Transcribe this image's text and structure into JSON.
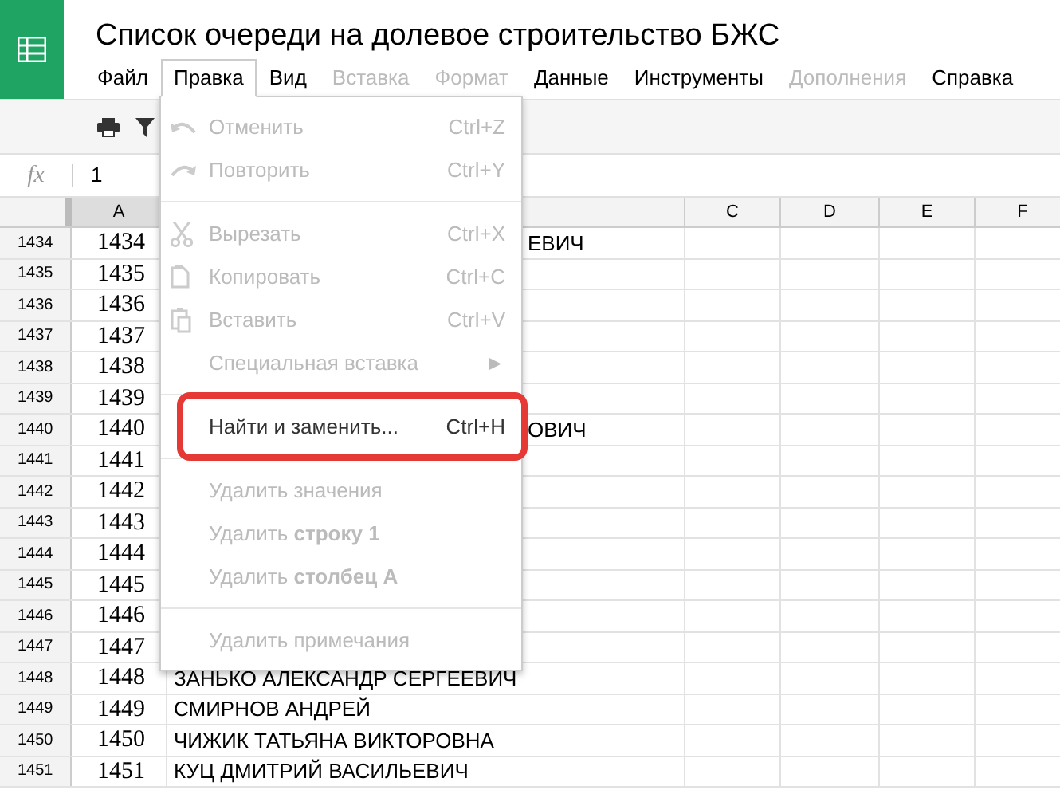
{
  "title": "Список очереди на долевое строительство БЖС",
  "menubar": [
    {
      "label": "Файл",
      "selected": false,
      "disabled": false
    },
    {
      "label": "Правка",
      "selected": true,
      "disabled": false
    },
    {
      "label": "Вид",
      "selected": false,
      "disabled": false
    },
    {
      "label": "Вставка",
      "selected": false,
      "disabled": true
    },
    {
      "label": "Формат",
      "selected": false,
      "disabled": true
    },
    {
      "label": "Данные",
      "selected": false,
      "disabled": false
    },
    {
      "label": "Инструменты",
      "selected": false,
      "disabled": false
    },
    {
      "label": "Дополнения",
      "selected": false,
      "disabled": true
    },
    {
      "label": "Справка",
      "selected": false,
      "disabled": false
    }
  ],
  "formula_bar": {
    "label": "fx",
    "value": "1"
  },
  "columns": [
    "A",
    "",
    "C",
    "D",
    "E",
    "F"
  ],
  "rows": [
    {
      "number": "1434",
      "a": "1434",
      "b": "ЕВИЧ",
      "kind": "partial"
    },
    {
      "number": "1435",
      "a": "1435"
    },
    {
      "number": "1436",
      "a": "1436"
    },
    {
      "number": "1437",
      "a": "1437"
    },
    {
      "number": "1438",
      "a": "1438"
    },
    {
      "number": "1439",
      "a": "1439"
    },
    {
      "number": "1440",
      "a": "1440",
      "b": "ОВИЧ",
      "kind": "partial"
    },
    {
      "number": "1441",
      "a": "1441"
    },
    {
      "number": "1442",
      "a": "1442"
    },
    {
      "number": "1443",
      "a": "1443"
    },
    {
      "number": "1444",
      "a": "1444"
    },
    {
      "number": "1445",
      "a": "1445"
    },
    {
      "number": "1446",
      "a": "1446"
    },
    {
      "number": "1447",
      "a": "1447"
    },
    {
      "number": "1448",
      "a": "1448",
      "b": "ЗАНЬКО АЛЕКСАНДР СЕРГЕЕВИЧ",
      "kind": "full"
    },
    {
      "number": "1449",
      "a": "1449",
      "b": "СМИРНОВ АНДРЕЙ",
      "kind": "full"
    },
    {
      "number": "1450",
      "a": "1450",
      "b": "ЧИЖИК ТАТЬЯНА ВИКТОРОВНА",
      "kind": "full"
    },
    {
      "number": "1451",
      "a": "1451",
      "b": "КУЦ ДМИТРИЙ ВАСИЛЬЕВИЧ",
      "kind": "full"
    }
  ],
  "edit_menu": [
    {
      "kind": "item",
      "label": "Отменить",
      "shortcut": "Ctrl+Z",
      "disabled": true,
      "marked": false
    },
    {
      "kind": "item",
      "label": "Повторить",
      "shortcut": "Ctrl+Y",
      "disabled": true,
      "marked": false
    },
    {
      "kind": "separator"
    },
    {
      "kind": "item",
      "label": "Вырезать",
      "shortcut": "Ctrl+X",
      "disabled": true,
      "marked": false
    },
    {
      "kind": "item",
      "label": "Копировать",
      "shortcut": "Ctrl+C",
      "disabled": true,
      "marked": false
    },
    {
      "kind": "item",
      "label": "Вставить",
      "shortcut": "Ctrl+V",
      "disabled": true,
      "marked": false
    },
    {
      "kind": "item",
      "label": "Специальная вставка",
      "shortcut": "►",
      "disabled": true,
      "marked": false
    },
    {
      "kind": "separator"
    },
    {
      "kind": "item",
      "label": "Найти и заменить...",
      "shortcut": "Ctrl+H",
      "disabled": false,
      "marked": true
    },
    {
      "kind": "separator"
    },
    {
      "kind": "item",
      "label": "Удалить значения",
      "disabled": true,
      "marked": false
    },
    {
      "kind": "item",
      "label": "Удалить **строку 1**",
      "disabled": true,
      "marked": false
    },
    {
      "kind": "item",
      "label": "Удалить **столбец A**",
      "disabled": true,
      "marked": false
    },
    {
      "kind": "separator"
    },
    {
      "kind": "item",
      "label": "Удалить примечания",
      "disabled": true,
      "marked": false
    }
  ]
}
